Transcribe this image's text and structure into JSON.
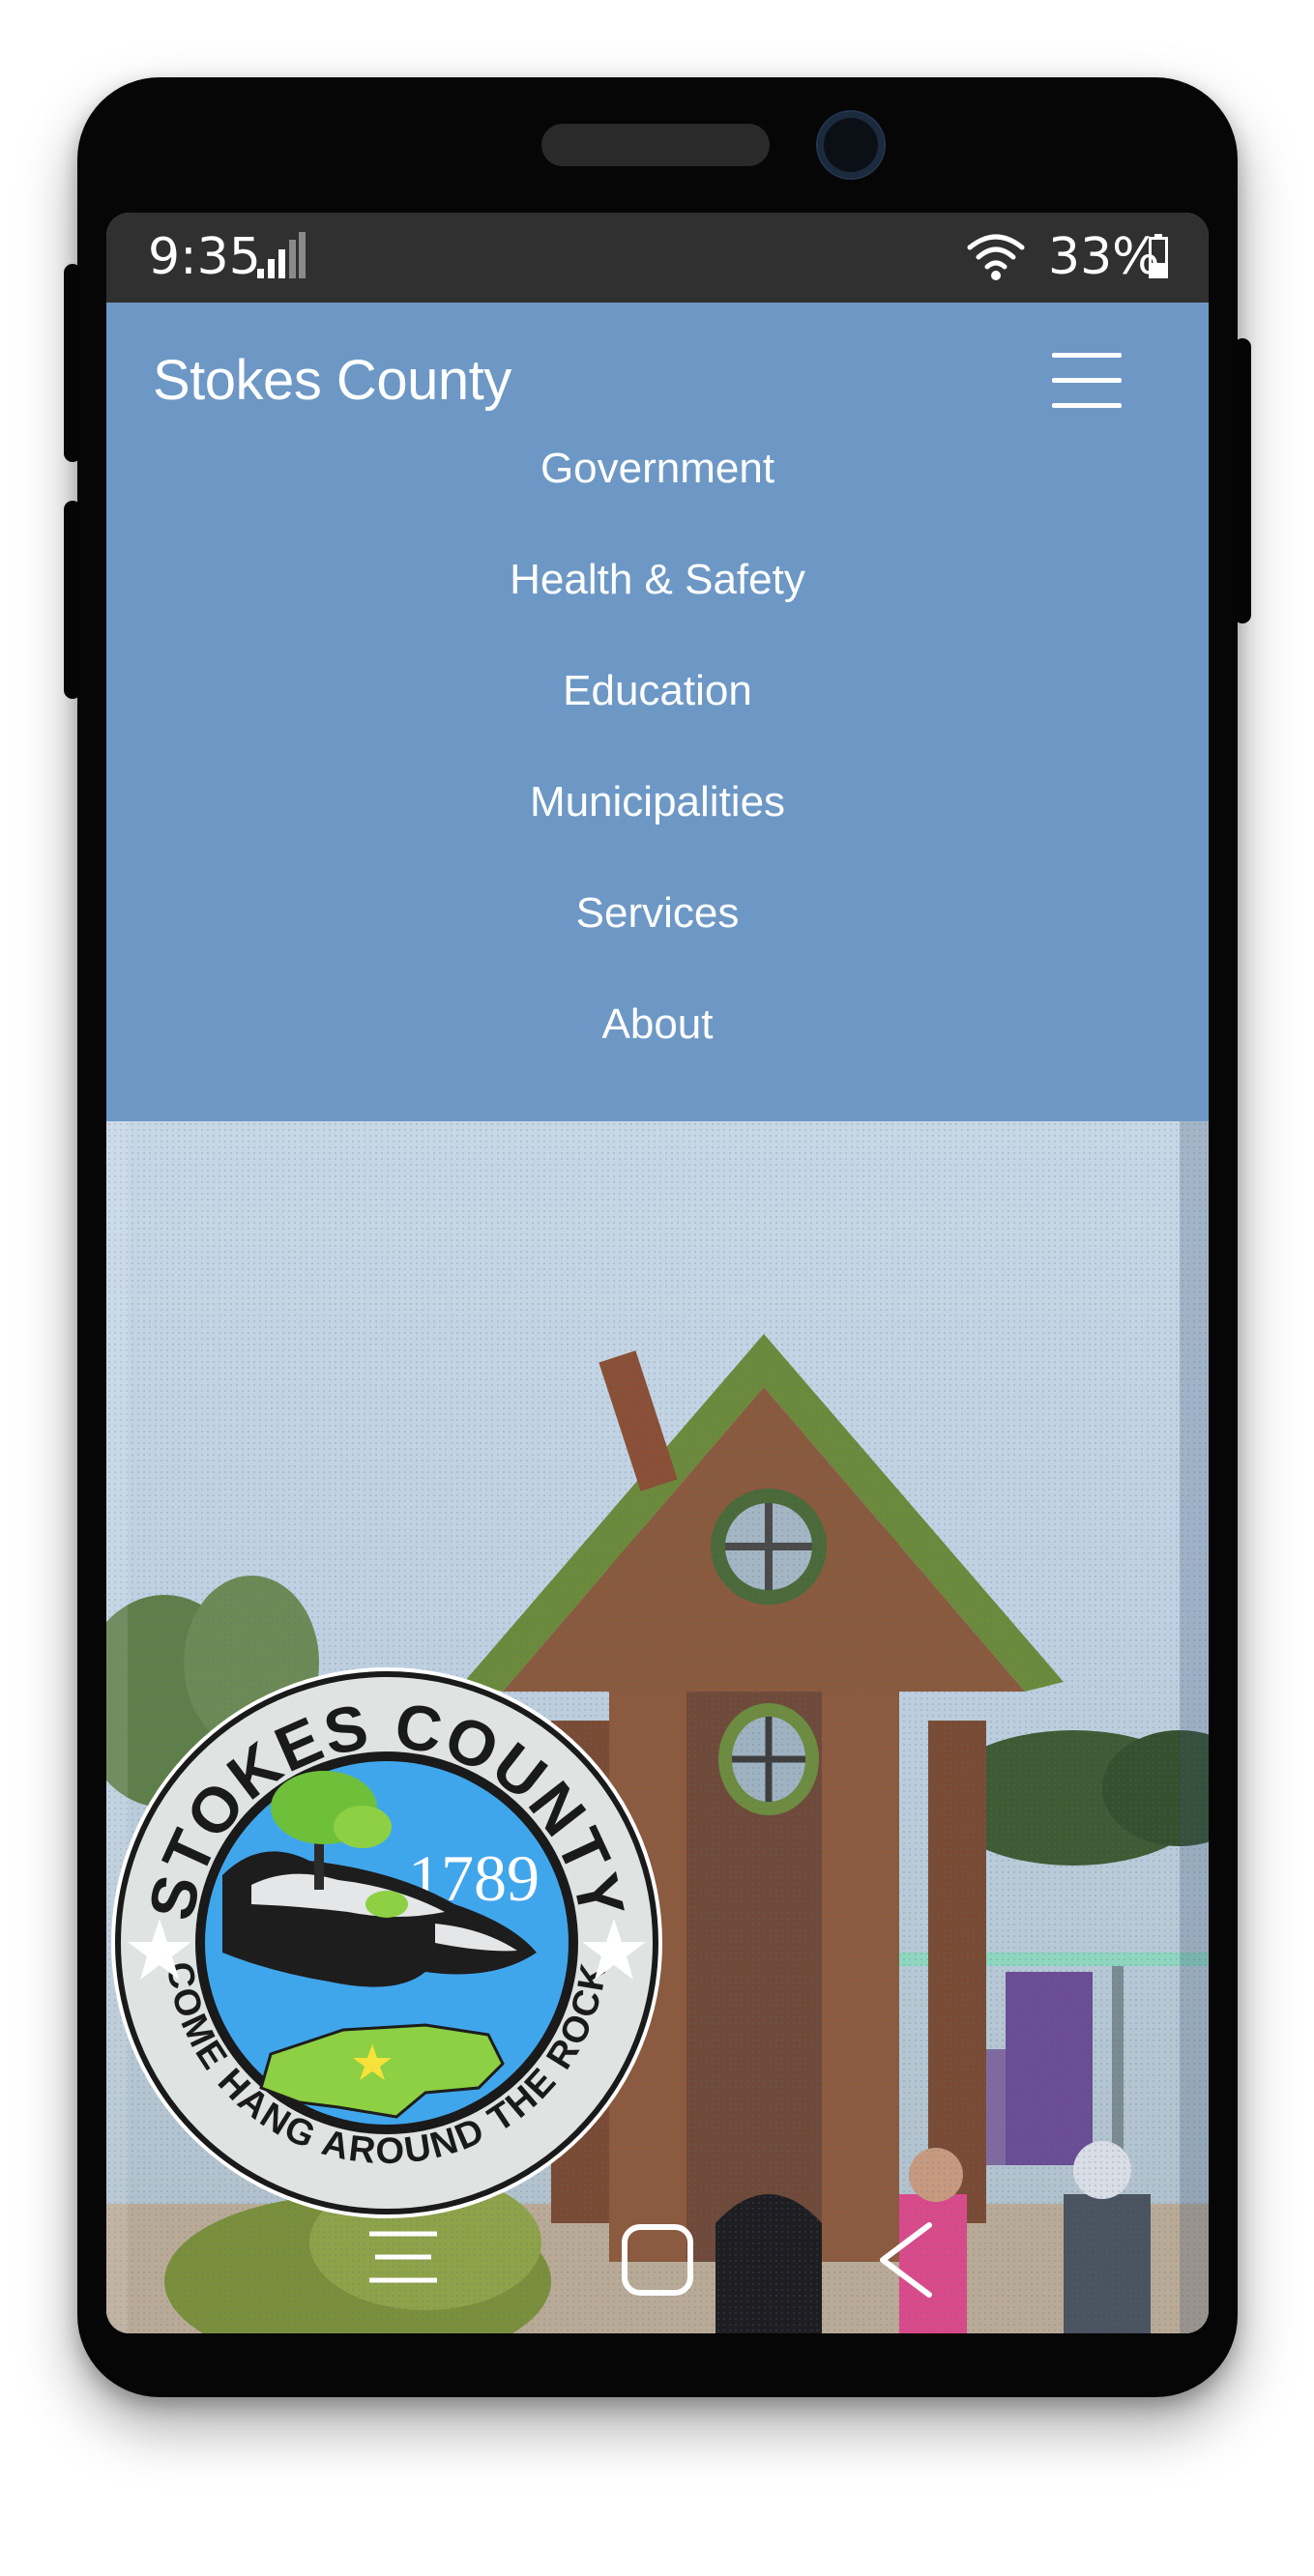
{
  "status_bar": {
    "time": "9:35",
    "battery": "33%",
    "icons": [
      "signal-icon",
      "wifi-icon",
      "battery-icon"
    ]
  },
  "header": {
    "brand": "Stokes County",
    "menu_icon": "hamburger-menu-icon"
  },
  "menu": {
    "items": [
      {
        "label": "Government"
      },
      {
        "label": "Health & Safety"
      },
      {
        "label": "Education"
      },
      {
        "label": "Municipalities"
      },
      {
        "label": "Services"
      },
      {
        "label": "About"
      }
    ]
  },
  "seal": {
    "top_text": "STOKES COUNTY",
    "year": "1789",
    "bottom_text": "COME HANG AROUND THE ROCK"
  },
  "system_nav": {
    "icons": [
      "recents-icon",
      "home-icon",
      "back-icon"
    ]
  },
  "colors": {
    "nav_background": "#6d98c5",
    "status_bar": "#303030",
    "seal_blue": "#40a6ec",
    "seal_green": "#8dd043"
  }
}
